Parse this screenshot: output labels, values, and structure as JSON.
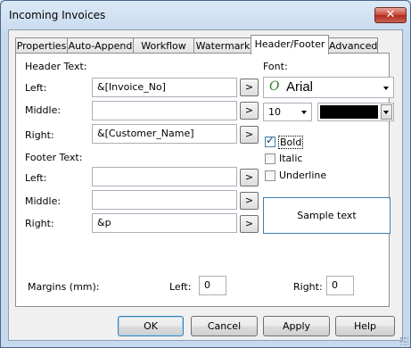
{
  "window": {
    "title": "Incoming Invoices",
    "close_glyph": "✕"
  },
  "tabs": [
    "Properties",
    "Auto-Append",
    "Workflow",
    "Watermark",
    "Header/Footer",
    "Advanced"
  ],
  "active_tab": "Header/Footer",
  "header": {
    "section_label": "Header Text:",
    "left_label": "Left:",
    "left_value": "&[Invoice_No]",
    "middle_label": "Middle:",
    "middle_value": "",
    "right_label": "Right:",
    "right_value": "&[Customer_Name]"
  },
  "footer": {
    "section_label": "Footer Text:",
    "left_label": "Left:",
    "left_value": "",
    "middle_label": "Middle:",
    "middle_value": "",
    "right_label": "Right:",
    "right_value": "&p"
  },
  "insert_button_glyph": ">",
  "font": {
    "label": "Font:",
    "name": "Arial",
    "type_icon": "opentype-font-icon",
    "size": "10",
    "color": "#000000",
    "bold_label": "Bold",
    "bold_checked": true,
    "italic_label": "Italic",
    "italic_checked": false,
    "underline_label": "Underline",
    "underline_checked": false,
    "sample_text": "Sample text"
  },
  "margins": {
    "label": "Margins (mm):",
    "left_label": "Left:",
    "left_value": "0",
    "right_label": "Right:",
    "right_value": "0"
  },
  "buttons": {
    "ok": "OK",
    "cancel": "Cancel",
    "apply": "Apply",
    "help": "Help"
  }
}
